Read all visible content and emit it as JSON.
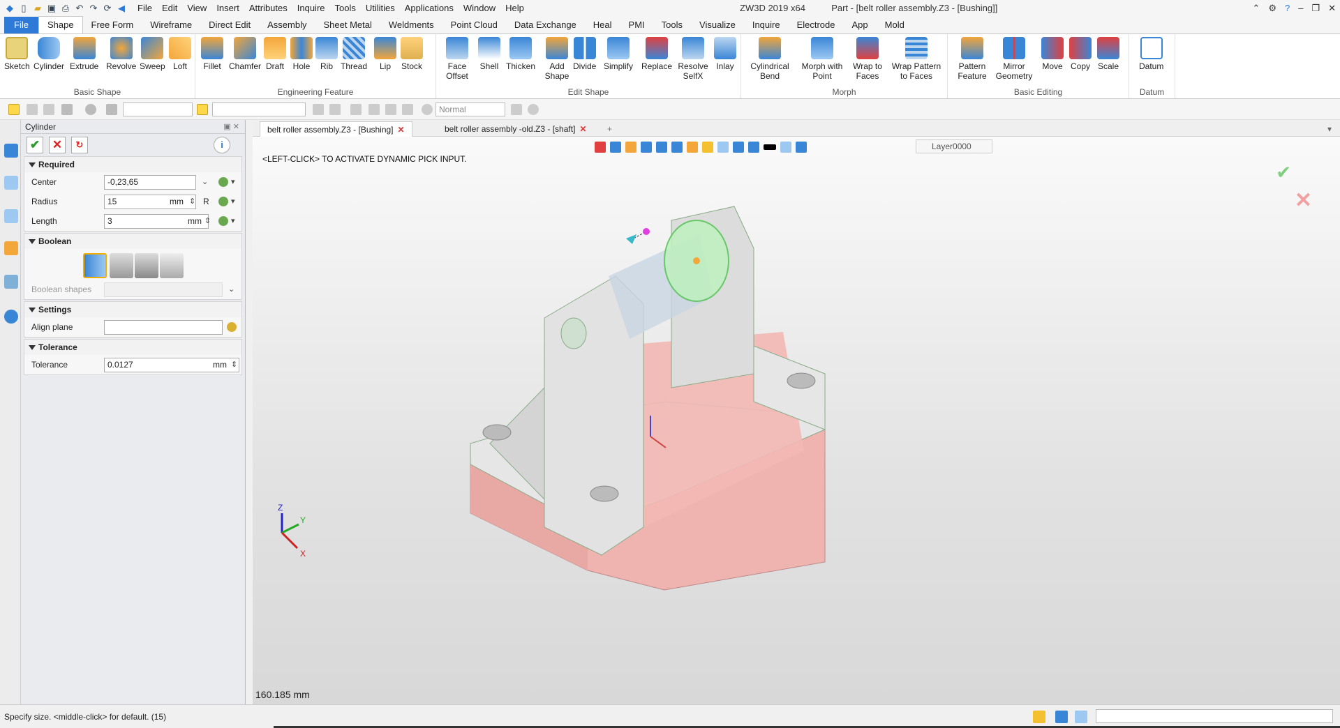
{
  "app_title": "ZW3D 2019  x64",
  "window_title": "Part - [belt roller assembly.Z3 - [Bushing]]",
  "menu": [
    "File",
    "Edit",
    "View",
    "Insert",
    "Attributes",
    "Inquire",
    "Tools",
    "Utilities",
    "Applications",
    "Window",
    "Help"
  ],
  "ribbon_tabs": [
    "File",
    "Shape",
    "Free Form",
    "Wireframe",
    "Direct Edit",
    "Assembly",
    "Sheet Metal",
    "Weldments",
    "Point Cloud",
    "Data Exchange",
    "Heal",
    "PMI",
    "Tools",
    "Visualize",
    "Inquire",
    "Electrode",
    "App",
    "Mold"
  ],
  "ribbon_groups": [
    {
      "label": "Basic Shape",
      "buttons": [
        "Sketch",
        "Cylinder",
        "Extrude",
        "Revolve",
        "Sweep",
        "Loft"
      ]
    },
    {
      "label": "Engineering Feature",
      "buttons": [
        "Fillet",
        "Chamfer",
        "Draft",
        "Hole",
        "Rib",
        "Thread",
        "Lip",
        "Stock"
      ]
    },
    {
      "label": "Edit Shape",
      "buttons": [
        "Face Offset",
        "Shell",
        "Thicken",
        "Add Shape",
        "Divide",
        "Simplify",
        "Replace",
        "Resolve SelfX",
        "Inlay"
      ]
    },
    {
      "label": "Morph",
      "buttons": [
        "Cylindrical Bend",
        "Morph with Point",
        "Wrap to Faces",
        "Wrap Pattern to Faces"
      ]
    },
    {
      "label": "Basic Editing",
      "buttons": [
        "Pattern Feature",
        "Mirror Geometry",
        "Move",
        "Copy",
        "Scale"
      ]
    },
    {
      "label": "Datum",
      "buttons": [
        "Datum"
      ]
    }
  ],
  "toolbar2": {
    "render_mode": "Normal"
  },
  "panel": {
    "title": "Cylinder",
    "sections": {
      "required": "Required",
      "boolean": "Boolean",
      "settings": "Settings",
      "tolerance": "Tolerance"
    },
    "center": {
      "label": "Center",
      "value": "-0,23,65"
    },
    "radius": {
      "label": "Radius",
      "value": "15",
      "unit": "mm",
      "suffix": "R"
    },
    "length": {
      "label": "Length",
      "value": "3",
      "unit": "mm"
    },
    "boolean_shapes": {
      "label": "Boolean shapes"
    },
    "align_plane": {
      "label": "Align plane",
      "value": ""
    },
    "tolerance": {
      "label": "Tolerance",
      "value": "0.0127",
      "unit": "mm"
    }
  },
  "doc_tabs": [
    {
      "label": "belt roller assembly.Z3 - [Bushing]",
      "active": true
    },
    {
      "label": "belt roller assembly -old.Z3 - [shaft]",
      "active": false
    }
  ],
  "viewport": {
    "hint": "<LEFT-CLICK> TO ACTIVATE DYNAMIC PICK INPUT.",
    "layer": "Layer0000",
    "measure": "160.185 mm",
    "axis_labels": {
      "x": "X",
      "y": "Y",
      "z": "Z"
    }
  },
  "status": {
    "text": "Specify size.  <middle-click> for default. (15)"
  },
  "colors": {
    "accent": "#2f7ad6",
    "part_fill": "#d8d8d8",
    "base_face": "#f0b4b0",
    "selected": "#8fe08f"
  }
}
